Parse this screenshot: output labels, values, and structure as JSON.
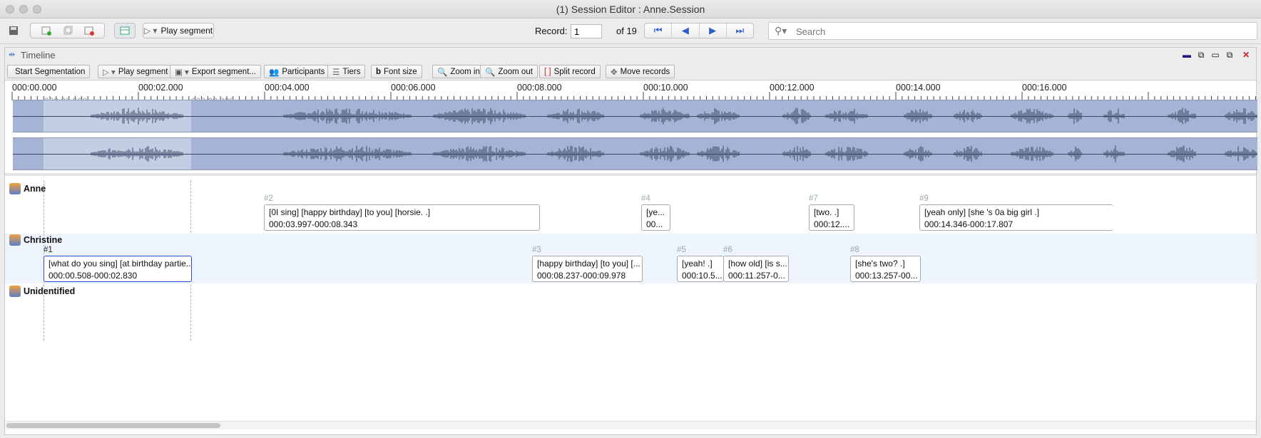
{
  "window": {
    "title": "(1) Session Editor : Anne.Session"
  },
  "toolbar": {
    "play_segment_label": "Play segment",
    "record_label": "Record:",
    "record_value": "1",
    "record_of": "of 19",
    "search_placeholder": "Search"
  },
  "timeline": {
    "panel_title": "Timeline",
    "buttons": {
      "start_segmentation": "Start Segmentation",
      "play_segment": "Play segment",
      "export_segment": "Export segment...",
      "participants": "Participants",
      "tiers": "Tiers",
      "font_size": "Font size",
      "zoom_in": "Zoom in",
      "zoom_out": "Zoom out",
      "split_record": "Split record",
      "move_records": "Move records"
    },
    "ticks": [
      "000:00.000",
      "000:02.000",
      "000:04.000",
      "000:06.000",
      "000:08.000",
      "000:10.000",
      "000:12.000",
      "000:14.000",
      "000:16.000"
    ],
    "selection": {
      "start": "000:00.508",
      "end": "000:02.830"
    },
    "speakers": [
      {
        "name": "Anne"
      },
      {
        "name": "Christine"
      },
      {
        "name": "Unidentified"
      }
    ],
    "segments": [
      {
        "num": "#2",
        "text": "[0I sing] [happy birthday] [to you] [horsie. .]",
        "time": "000:03.997-000:08.343"
      },
      {
        "num": "#4",
        "text": "[ye...",
        "time": "00..."
      },
      {
        "num": "#7",
        "text": "[two. .]",
        "time": "000:12...."
      },
      {
        "num": "#9",
        "text": "[yeah only] [she 's 0a big girl .]",
        "time": "000:14.346-000:17.807"
      },
      {
        "num": "#1",
        "text": "[what do you sing] [at birthday partie...",
        "time": "000:00.508-000:02.830"
      },
      {
        "num": "#3",
        "text": "[happy birthday] [to you] [...",
        "time": "000:08.237-000:09.978"
      },
      {
        "num": "#5",
        "text": "[yeah! .]",
        "time": "000:10.5..."
      },
      {
        "num": "#6",
        "text": "[how old] [is s...",
        "time": "000:11.257-0..."
      },
      {
        "num": "#8",
        "text": "[she's two? .]",
        "time": "000:13.257-00..."
      }
    ]
  }
}
